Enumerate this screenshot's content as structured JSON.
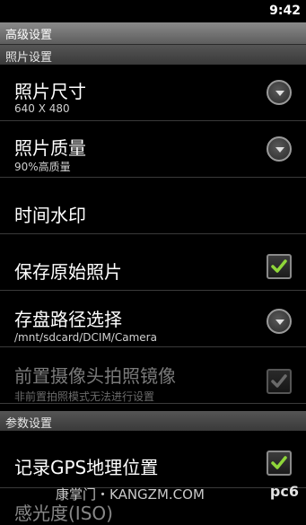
{
  "status_bar": {
    "time": "9:42"
  },
  "title_bar": {
    "title": "高级设置"
  },
  "sections": {
    "photo": "照片设置",
    "params": "参数设置"
  },
  "rows": {
    "photo_size": {
      "title": "照片尺寸",
      "summary": "640 X 480"
    },
    "photo_quality": {
      "title": "照片质量",
      "summary": "90%高质量"
    },
    "time_watermark": {
      "title": "时间水印"
    },
    "save_original": {
      "title": "保存原始照片",
      "checked": true
    },
    "save_path": {
      "title": "存盘路径选择",
      "summary": "/mnt/sdcard/DCIM/Camera"
    },
    "front_mirror": {
      "title": "前置摄像头拍照镜像",
      "summary": "非前置拍照模式无法进行设置",
      "checked": true,
      "disabled": true
    },
    "record_gps": {
      "title": "记录GPS地理位置",
      "checked": true
    },
    "iso": {
      "title": "感光度(ISO)"
    }
  },
  "watermark": {
    "text": "康掌门・KANGZM.COM",
    "logo": "pc6"
  },
  "colors": {
    "check": "#8fd63a",
    "check_disabled": "#6a6a6a"
  }
}
